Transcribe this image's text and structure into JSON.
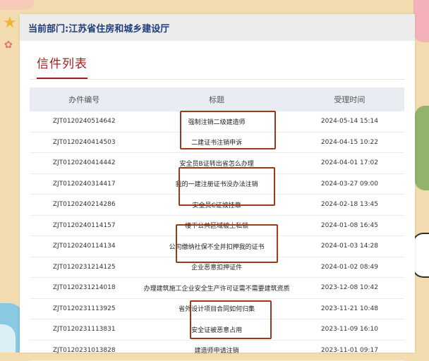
{
  "department": {
    "label": "当前部门:",
    "name": "江苏省住房和城乡建设厅"
  },
  "section_title": "信件列表",
  "table": {
    "headers": [
      "办件编号",
      "标题",
      "受理时间"
    ],
    "rows": [
      {
        "id": "ZJT0120240514642",
        "title": "强制注销二级建造师",
        "time": "2024-05-14 15:14"
      },
      {
        "id": "ZJT0120240414503",
        "title": "二建证书注销申诉",
        "time": "2024-04-15 10:22"
      },
      {
        "id": "ZJT0120240414442",
        "title": "安全员B证转出省怎么办理",
        "time": "2024-04-01 17:02"
      },
      {
        "id": "ZJT0120240314417",
        "title": "我的一建注册证书没办法注销",
        "time": "2024-03-27 09:00"
      },
      {
        "id": "ZJT0120240214286",
        "title": "安全员C证被挂靠",
        "time": "2024-02-18 13:45"
      },
      {
        "id": "ZJT0120240114157",
        "title": "楼下公共区域被上私锁",
        "time": "2024-01-08 16:45"
      },
      {
        "id": "ZJT0120240114134",
        "title": "公司缴纳社保不全并扣押我的证书",
        "time": "2024-01-03 14:28"
      },
      {
        "id": "ZJT0120231214125",
        "title": "企业恶意扣押证件",
        "time": "2024-01-02 08:49"
      },
      {
        "id": "ZJT0120231214018",
        "title": "办理建筑施工企业安全生产许可证需不需要建筑资质",
        "time": "2023-12-08 10:42"
      },
      {
        "id": "ZJT0120231113925",
        "title": "省外设计项目合同如何归集",
        "time": "2023-11-21 10:48"
      },
      {
        "id": "ZJT0120231113831",
        "title": "安全证被恶意占用",
        "time": "2023-11-09 16:10"
      },
      {
        "id": "ZJT0120231013828",
        "title": "建造师申请注销",
        "time": "2023-11-01 09:17"
      }
    ]
  },
  "colors": {
    "accent_red": "#9d1f1f",
    "dept_blue": "#1f3d7a",
    "highlight_box": "#9a3a17",
    "background": "#f3ddb0"
  }
}
